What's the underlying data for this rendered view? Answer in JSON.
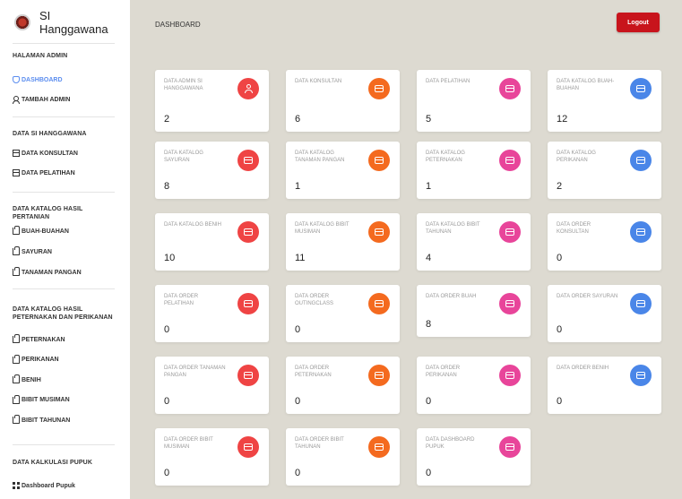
{
  "brand": {
    "name": "SI Hanggawana"
  },
  "sidebar": {
    "sections": [
      {
        "title": "HALAMAN ADMIN",
        "items": [
          {
            "label": "DASHBOARD",
            "icon": "dashboard-icon",
            "active": true
          },
          {
            "label": "TAMBAH ADMIN",
            "icon": "user-add-icon"
          }
        ]
      },
      {
        "title": "DATA SI HANGGAWANA",
        "items": [
          {
            "label": "DATA KONSULTAN",
            "icon": "table-icon"
          },
          {
            "label": "DATA PELATIHAN",
            "icon": "table-icon"
          }
        ]
      },
      {
        "title": "DATA KATALOG HASIL PERTANIAN",
        "items": [
          {
            "label": "BUAH-BUAHAN",
            "icon": "bag-icon"
          },
          {
            "label": "SAYURAN",
            "icon": "bag-icon"
          },
          {
            "label": "TANAMAN PANGAN",
            "icon": "bag-icon"
          }
        ]
      },
      {
        "title": "DATA KATALOG HASIL PETERNAKAN DAN PERIKANAN",
        "items": [
          {
            "label": "PETERNAKAN",
            "icon": "bag-icon"
          },
          {
            "label": "PERIKANAN",
            "icon": "bag-icon"
          },
          {
            "label": "BENIH",
            "icon": "bag-icon"
          },
          {
            "label": "BIBIT MUSIMAN",
            "icon": "bag-icon"
          },
          {
            "label": "BIBIT TAHUNAN",
            "icon": "bag-icon"
          }
        ]
      },
      {
        "title": "DATA KALKULASI PUPUK",
        "items": [
          {
            "label": "Dashboard Pupuk",
            "icon": "grid-icon"
          }
        ]
      }
    ]
  },
  "header": {
    "title": "DASHBOARD",
    "logout_label": "Logout"
  },
  "colors": {
    "red": "#ef4444",
    "orange": "#f46a1f",
    "pink": "#e8459a",
    "blue": "#4a86e8",
    "logout": "#c8141c",
    "active_nav": "#5b8def"
  },
  "cards": [
    {
      "label": "DATA ADMIN SI HANGGAWANA",
      "value": "2",
      "color": "red",
      "icon": "user-icon"
    },
    {
      "label": "DATA KONSULTAN",
      "value": "6",
      "color": "orange",
      "icon": "table-icon"
    },
    {
      "label": "DATA PELATIHAN",
      "value": "5",
      "color": "pink",
      "icon": "table-icon"
    },
    {
      "label": "DATA KATALOG BUAH-BUAHAN",
      "value": "12",
      "color": "blue",
      "icon": "table-icon"
    },
    {
      "label": "DATA KATALOG SAYURAN",
      "value": "8",
      "color": "red",
      "icon": "table-icon"
    },
    {
      "label": "DATA KATALOG TANAMAN PANGAN",
      "value": "1",
      "color": "orange",
      "icon": "table-icon"
    },
    {
      "label": "DATA KATALOG PETERNAKAN",
      "value": "1",
      "color": "pink",
      "icon": "table-icon"
    },
    {
      "label": "DATA KATALOG PERIKANAN",
      "value": "2",
      "color": "blue",
      "icon": "table-icon"
    },
    {
      "label": "DATA KATALOG BENIH",
      "value": "10",
      "color": "red",
      "icon": "table-icon"
    },
    {
      "label": "DATA KATALOG BIBIT MUSIMAN",
      "value": "11",
      "color": "orange",
      "icon": "table-icon"
    },
    {
      "label": "DATA KATALOG BIBIT TAHUNAN",
      "value": "4",
      "color": "pink",
      "icon": "table-icon"
    },
    {
      "label": "DATA ORDER KONSULTAN",
      "value": "0",
      "color": "blue",
      "icon": "table-icon"
    },
    {
      "label": "DATA ORDER PELATIHAN",
      "value": "0",
      "color": "red",
      "icon": "table-icon"
    },
    {
      "label": "DATA ORDER OUTINGCLASS",
      "value": "0",
      "color": "orange",
      "icon": "table-icon"
    },
    {
      "label": "DATA ORDER BUAH",
      "value": "8",
      "color": "pink",
      "icon": "table-icon"
    },
    {
      "label": "DATA ORDER SAYURAN",
      "value": "0",
      "color": "blue",
      "icon": "table-icon"
    },
    {
      "label": "DATA ORDER TANAMAN PANGAN",
      "value": "0",
      "color": "red",
      "icon": "table-icon"
    },
    {
      "label": "DATA ORDER PETERNAKAN",
      "value": "0",
      "color": "orange",
      "icon": "table-icon"
    },
    {
      "label": "DATA ORDER PERIKANAN",
      "value": "0",
      "color": "pink",
      "icon": "table-icon"
    },
    {
      "label": "DATA ORDER BENIH",
      "value": "0",
      "color": "blue",
      "icon": "table-icon"
    },
    {
      "label": "DATA ORDER BIBIT MUSIMAN",
      "value": "0",
      "color": "red",
      "icon": "table-icon"
    },
    {
      "label": "DATA ORDER BIBIT TAHUNAN",
      "value": "0",
      "color": "orange",
      "icon": "table-icon"
    },
    {
      "label": "DATA DASHBOARD PUPUK",
      "value": "0",
      "color": "pink",
      "icon": "table-icon"
    }
  ]
}
